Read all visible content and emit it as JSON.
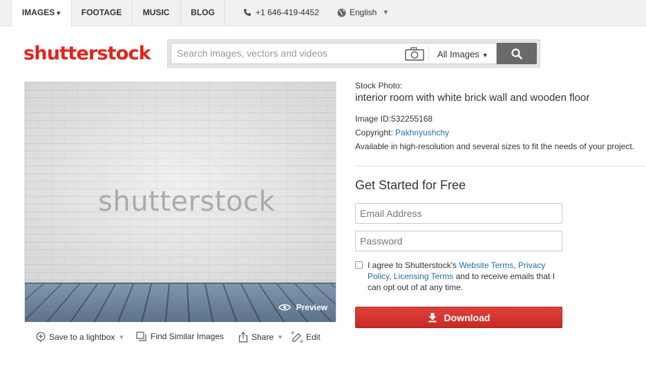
{
  "topnav": {
    "tabs": [
      {
        "label": "IMAGES",
        "active": true
      },
      {
        "label": "FOOTAGE"
      },
      {
        "label": "MUSIC"
      },
      {
        "label": "BLOG"
      }
    ],
    "phone": "+1 646-419-4452",
    "language": "English"
  },
  "header": {
    "logo": "shutterstock",
    "search": {
      "placeholder": "Search images, vectors and videos",
      "category": "All Images"
    }
  },
  "image": {
    "watermark": "shutterstock",
    "preview_label": "Preview"
  },
  "image_actions": {
    "save": "Save to a lightbox",
    "similar": "Find Similar Images",
    "share": "Share",
    "edit": "Edit"
  },
  "details": {
    "label": "Stock Photo:",
    "title": "interior room with white brick wall and wooden floor",
    "image_id": "Image ID:532255168",
    "copyright_label": "Copyright:",
    "copyright_author": "Pakhnyushchy",
    "availability": "Available in high-resolution and several sizes to fit the needs of your project."
  },
  "signup": {
    "heading": "Get Started for Free",
    "email_placeholder": "Email Address",
    "password_placeholder": "Password",
    "agree_prefix": "I agree to Shutterstock's ",
    "terms_website": "Website Terms",
    "sep1": ", ",
    "terms_privacy": "Privacy Policy",
    "sep2": ", ",
    "terms_licensing": "Licensing Terms",
    "agree_suffix": " and to receive emails that I can opt out of at any time.",
    "download_label": "Download"
  },
  "colors": {
    "brand": "#e1251b",
    "link": "#1f6fa5",
    "download": "#d13630"
  }
}
